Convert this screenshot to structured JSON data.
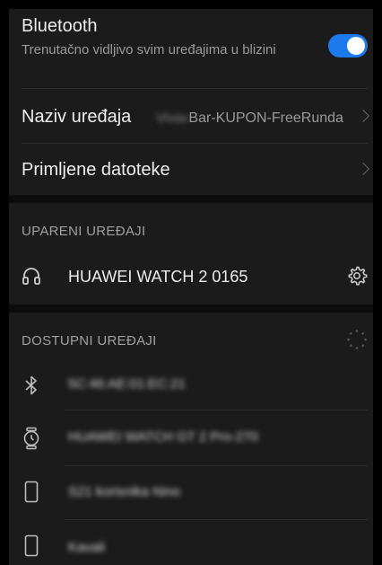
{
  "bluetooth": {
    "title": "Bluetooth",
    "subtitle": "Trenutačno vidljivo svim uređajima u blizini",
    "enabled": true,
    "toggle_color": "#1c7aec"
  },
  "device_name": {
    "label": "Naziv uređaja",
    "value_blurred": "Vivax",
    "value": "Bar-KUPON-FreeRunda"
  },
  "received_files": {
    "label": "Primljene datoteke"
  },
  "paired_section": {
    "title": "UPARENI UREĐAJI",
    "devices": [
      {
        "name": "HUAWEI WATCH 2 0165",
        "icon": "headphones-icon"
      }
    ]
  },
  "available_section": {
    "title": "DOSTUPNI UREĐAJI",
    "devices": [
      {
        "name": "5C:46:AE:01:EC:21",
        "icon": "bluetooth-icon"
      },
      {
        "name": "HUAWEI WATCH GT 2 Pro-270",
        "icon": "watch-icon"
      },
      {
        "name": "S21 korisnika Nino",
        "icon": "phone-icon"
      },
      {
        "name": "Kavali",
        "icon": "phone-icon"
      }
    ]
  }
}
